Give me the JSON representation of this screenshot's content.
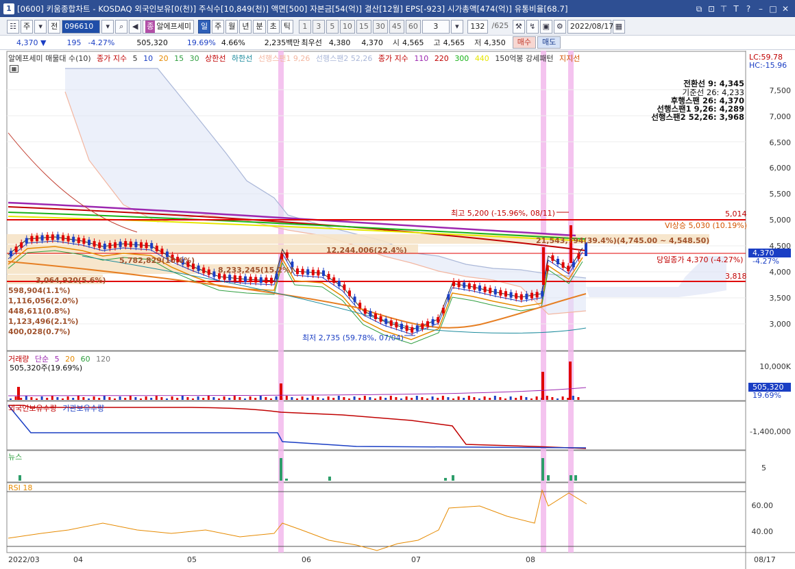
{
  "title_bar": {
    "app_number": "1",
    "title": "[0600] 키움종합차트 - KOSDAQ 외국인보유[0(천)] 주식수[10,849(천)] 액면[500] 자본금[54(억)] 결산[12월] EPS[-923] 시가총액[474(억)] 유통비율[68.7]"
  },
  "toolbar": {
    "mode": "주",
    "prev_label": "전",
    "code": "096610",
    "portfolio_badge": "종",
    "stock_name": "알에프세미",
    "periods": [
      "일",
      "주",
      "월",
      "년",
      "분",
      "초",
      "틱"
    ],
    "active_period": "일",
    "intervals": [
      "1",
      "3",
      "5",
      "10",
      "15",
      "30",
      "45",
      "60"
    ],
    "interval_value": "3",
    "page_count": "132",
    "page_total": "/625",
    "date": "2022/08/17"
  },
  "quote": {
    "price": "4,370",
    "arrow": "▼",
    "change": "195",
    "change_pct": "-4.27%",
    "volume": "505,320",
    "volume_pct": "19.69%",
    "turnover": "4.66%",
    "amount": "2,235백만",
    "priority_label": "최우선",
    "priority_ask": "4,380",
    "priority_bid": "4,370",
    "open_label": "시",
    "open": "4,565",
    "high_label": "고",
    "high": "4,565",
    "low_label": "저",
    "low": "4,350",
    "buy_label": "매수",
    "sell_label": "매도"
  },
  "price_panel": {
    "legend": {
      "stock": "알에프세미 매물대 수(10)",
      "ma_title": "종가 지수",
      "ma_values": [
        "5",
        "10",
        "20",
        "15",
        "30"
      ],
      "upper": "상한선",
      "lower": "하한선",
      "span1": "선행스팬1 9,26",
      "span2": "선행스팬2 52,26",
      "ma2_title": "종가 지수",
      "ma2_values": [
        "110",
        "220",
        "300",
        "440"
      ],
      "pattern": "150억봉 강세패턴",
      "support": "지지선"
    },
    "lc_label": "LC:59.78",
    "hc_label": "HC:-15.96",
    "ichimoku": [
      {
        "label": "전환선 9: 4,345",
        "color": "#0a8a6a"
      },
      {
        "label": "기준선 26: 4,233",
        "color": "#333333"
      },
      {
        "label": "후행스팬 26: 4,370",
        "color": "#9c27b0"
      },
      {
        "label": "선행스팬1 9,26: 4,289",
        "color": "#f3b6a0"
      },
      {
        "label": "선행스팬2 52,26: 3,968",
        "color": "#aab7d8"
      }
    ],
    "y_ticks": [
      "7,500",
      "7,000",
      "6,500",
      "6,000",
      "5,500",
      "5,000",
      "4,500",
      "4,000",
      "3,500",
      "3,000"
    ],
    "annotations": {
      "high": "최고 5,200 (-15.96%, 08/11)",
      "low": "최저 2,735 (59.78%, 07/04)",
      "vi_up": "VI상승 5,030 (10.19%)",
      "today_close": "당일종가 4,370 (-4.27%)",
      "line_5014": "5,014",
      "line_3818": "3,818",
      "current_price": "4,370",
      "current_pct": "-4.27%",
      "profile_big": "21,543,794(39.4%)(4,745.00 ~ 4,548.50)",
      "profile_2": "12,244,006(22.4%)",
      "profile_3": "5,782,829(10.6%)",
      "profile_4": "8,233,245(15.2%)",
      "profile_5": "3,064,920(5.6%)",
      "profile_list": [
        "598,904(1.1%)",
        "1,116,056(2.0%)",
        "448,611(0.8%)",
        "1,123,496(2.1%)",
        "400,028(0.7%)"
      ]
    }
  },
  "volume_panel": {
    "legend_title": "거래량",
    "ma_title": "단순",
    "ma_values": [
      "5",
      "20",
      "60",
      "120"
    ],
    "volume_text": "505,320주(19.69%)",
    "y_tick": "10,000K",
    "current": "505,320",
    "current_pct": "19.69%"
  },
  "holding_panel": {
    "foreign_label": "외국인보유수량",
    "inst_label": "기관보유수량",
    "y_tick": "-1,400,000"
  },
  "news_panel": {
    "label": "뉴스",
    "y_tick": "5"
  },
  "rsi_panel": {
    "label": "RSI 18",
    "y_ticks": [
      "60.00",
      "40.00"
    ]
  },
  "x_axis": {
    "labels": [
      "2022/03",
      "04",
      "05",
      "06",
      "07",
      "08"
    ],
    "end_label": "08/17"
  }
}
